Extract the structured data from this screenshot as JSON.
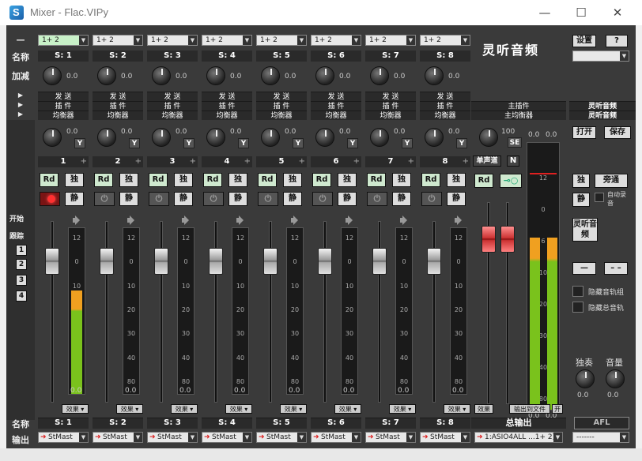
{
  "window": {
    "title": "Mixer - Flac.VIPy",
    "minimize": "—",
    "maximize": "☐",
    "close": "✕"
  },
  "row_labels": {
    "name": "名称",
    "gain": "加减",
    "pan": "声像",
    "name_bottom": "名称",
    "output": "输出"
  },
  "left_panel": {
    "start": "开始",
    "follow": "跟踪",
    "tracks": [
      "1",
      "2",
      "3",
      "4"
    ],
    "collapse": "—"
  },
  "channels": [
    {
      "input": "1+ 2",
      "name": "S: 1",
      "gain": "0.0",
      "pan": "0.0",
      "num": "1",
      "bottom_name": "S: 1",
      "output": "StMast",
      "peak": "0.0",
      "effect": "效果",
      "armed": true,
      "level": 0.62
    },
    {
      "input": "1+ 2",
      "name": "S: 2",
      "gain": "0.0",
      "pan": "0.0",
      "num": "2",
      "bottom_name": "S: 2",
      "output": "StMast",
      "peak": "0.0",
      "effect": "效果",
      "armed": false,
      "level": 0
    },
    {
      "input": "1+ 2",
      "name": "S: 3",
      "gain": "0.0",
      "pan": "0.0",
      "num": "3",
      "bottom_name": "S: 3",
      "output": "StMast",
      "peak": "0.0",
      "effect": "效果",
      "armed": false,
      "level": 0
    },
    {
      "input": "1+ 2",
      "name": "S: 4",
      "gain": "0.0",
      "pan": "0.0",
      "num": "4",
      "bottom_name": "S: 4",
      "output": "StMast",
      "peak": "0.0",
      "effect": "效果",
      "armed": false,
      "level": 0
    },
    {
      "input": "1+ 2",
      "name": "S: 5",
      "gain": "0.0",
      "pan": "0.0",
      "num": "5",
      "bottom_name": "S: 5",
      "output": "StMast",
      "peak": "0.0",
      "effect": "效果",
      "armed": false,
      "level": 0
    },
    {
      "input": "1+ 2",
      "name": "S: 6",
      "gain": "0.0",
      "pan": "0.0",
      "num": "6",
      "bottom_name": "S: 6",
      "output": "StMast",
      "peak": "0.0",
      "effect": "效果",
      "armed": false,
      "level": 0
    },
    {
      "input": "1+ 2",
      "name": "S: 7",
      "gain": "0.0",
      "pan": "0.0",
      "num": "7",
      "bottom_name": "S: 7",
      "output": "StMast",
      "peak": "0.0",
      "effect": "效果",
      "armed": false,
      "level": 0
    },
    {
      "input": "1+ 2",
      "name": "S: 8",
      "gain": "0.0",
      "pan": "0.0",
      "num": "8",
      "bottom_name": "S: 8",
      "output": "StMast",
      "peak": "0.0",
      "effect": "效果",
      "armed": false,
      "level": 0
    }
  ],
  "channel_labels": {
    "send": "发 送",
    "plugin": "插 件",
    "eq": "均衡器",
    "rd": "Rd",
    "solo": "独",
    "mute": "静"
  },
  "meter_scale": [
    "12",
    "0",
    "10",
    "20",
    "30",
    "40",
    "80"
  ],
  "master": {
    "logo": "灵听音频",
    "main_plugin": "主插件",
    "main_eq": "主均衡器",
    "pan_value": "100",
    "se": "SE",
    "mono": "单声道",
    "n": "N",
    "rd": "Rd",
    "effect": "效果",
    "label": "总输出",
    "record_btn": "输出到文件",
    "on": "开",
    "output": "1:ASIO4ALL ...1+ 2)",
    "left_peak": "0.0",
    "right_peak": "0.0",
    "scale": [
      "12",
      "0",
      "6",
      "10",
      "20",
      "30",
      "40",
      "80"
    ]
  },
  "right_panel": {
    "settings": "设置",
    "help": "?",
    "brand1": "灵听音频",
    "brand2": "灵听音频",
    "open": "打开",
    "save": "保存",
    "solo": "独",
    "bypass": "旁通",
    "mute": "静",
    "auto_record": "自动录音",
    "logo_btn": "灵听音频",
    "dash1": "—",
    "dash2": "– –",
    "hide_group": "隐藏音轨组",
    "hide_all": "隐藏总音轨",
    "solo_label": "独奏",
    "vol_label": "音量",
    "solo_val": "0.0",
    "vol_val": "0.0",
    "afl": "AFL",
    "footer_select": "-------"
  },
  "colors": {
    "bg": "#3a3a3a",
    "meter_green": "#7ac21c",
    "meter_orange": "#f0a020",
    "meter_red": "#e02020"
  }
}
